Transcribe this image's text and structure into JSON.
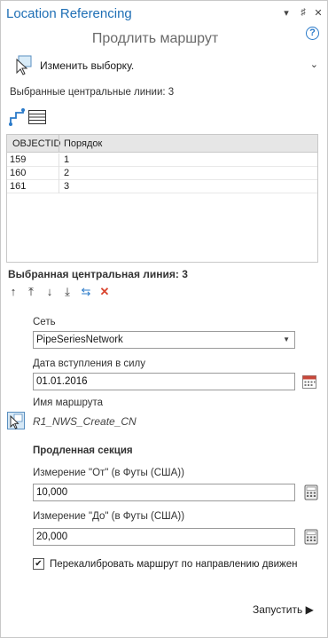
{
  "header": {
    "app_title": "Location Referencing",
    "window_controls": [
      "▾",
      "♯",
      "✕"
    ],
    "subtitle": "Продлить маршрут",
    "help_glyph": "?"
  },
  "selection": {
    "label": "Изменить выборку.",
    "chevron": "⌄"
  },
  "centerlines": {
    "label": "Выбранные центральные линии: 3",
    "columns": [
      "OBJECTID",
      "Порядок"
    ],
    "rows": [
      {
        "objectid": "159",
        "order": "1"
      },
      {
        "objectid": "160",
        "order": "2"
      },
      {
        "objectid": "161",
        "order": "3"
      }
    ]
  },
  "selected_line": {
    "label": "Выбранная центральная линия: 3",
    "tools": [
      "↑",
      "⤒",
      "↓",
      "⤓",
      "⇆",
      "✕"
    ]
  },
  "form": {
    "network_label": "Сеть",
    "network_value": "PipeSeriesNetwork",
    "dropdown_arrow": "▼",
    "effective_date_label": "Дата вступления в силу",
    "effective_date_value": "01.01.2016",
    "route_name_label": "Имя маршрута",
    "route_name_value": "R1_NWS_Create_CN",
    "extended_section_label": "Продленная секция",
    "from_measure_label": "Измерение \"От\" (в Футы (США))",
    "from_measure_value": "10,000",
    "to_measure_label": "Измерение \"До\" (в Футы (США))",
    "to_measure_value": "20,000",
    "recalibrate_label": "Перекалибровать маршрут по направлению движен",
    "recalibrate_checked": "✔"
  },
  "footer": {
    "run_label": "Запустить ▶"
  },
  "colors": {
    "accent": "#1f6fb5",
    "icon_blue": "#2a7ac9",
    "delete_red": "#d9442e",
    "calendar_red": "#c8473a"
  },
  "icons": [
    "select-cursor-icon",
    "chevron-down-icon",
    "route-line-icon",
    "table-view-icon",
    "move-up-icon",
    "move-top-icon",
    "move-down-icon",
    "move-bottom-icon",
    "reverse-icon",
    "delete-icon",
    "calendar-icon",
    "calculator-icon",
    "pick-route-icon",
    "help-icon"
  ]
}
